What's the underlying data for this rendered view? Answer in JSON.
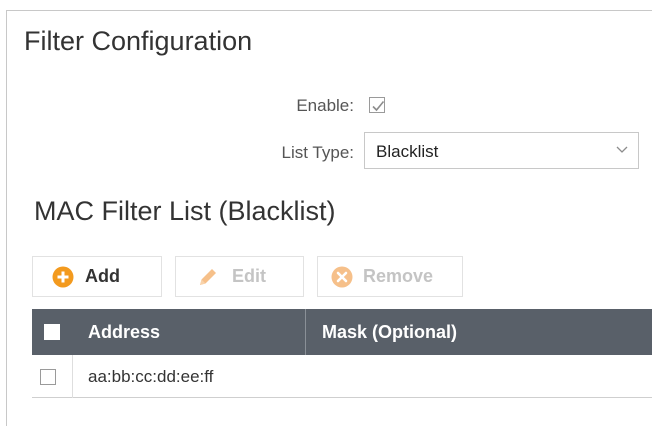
{
  "panel": {
    "title": "Filter Configuration"
  },
  "enable": {
    "label": "Enable:",
    "checked": true
  },
  "list_type": {
    "label": "List Type:",
    "value": "Blacklist"
  },
  "mac_list": {
    "title": "MAC Filter List (Blacklist)"
  },
  "toolbar": {
    "add_label": "Add",
    "edit_label": "Edit",
    "remove_label": "Remove"
  },
  "table": {
    "columns": [
      "Address",
      "Mask (Optional)"
    ],
    "rows": [
      {
        "address": "aa:bb:cc:dd:ee:ff",
        "mask": ""
      }
    ]
  },
  "colors": {
    "accent_orange": "#f39a1e",
    "disabled_orange": "#f6c08a",
    "header_bg": "#596069"
  },
  "icons": {
    "add": "plus-circle-icon",
    "edit": "pencil-icon",
    "remove": "x-circle-icon",
    "select": "chevron-down-icon",
    "enable": "checkmark-icon"
  }
}
